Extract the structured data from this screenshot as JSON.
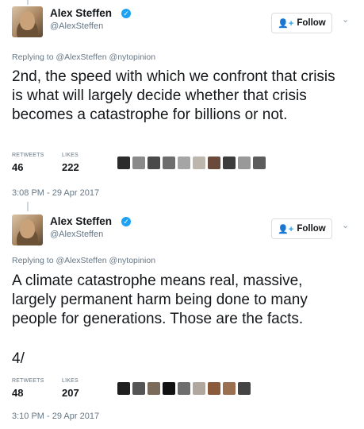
{
  "tweets": [
    {
      "author": "Alex Steffen",
      "handle": "@AlexSteffen",
      "follow_label": "Follow",
      "replying": "Replying to @AlexSteffen @nytopinion",
      "text": "2nd, the speed with which we confront that crisis is what will largely decide whether that crisis becomes a catastrophe for billions or not.",
      "retweets_label": "RETWEETS",
      "retweets": "46",
      "likes_label": "LIKES",
      "likes": "222",
      "timestamp": "3:08 PM - 29 Apr 2017"
    },
    {
      "author": "Alex Steffen",
      "handle": "@AlexSteffen",
      "follow_label": "Follow",
      "replying": "Replying to @AlexSteffen @nytopinion",
      "text": "A climate catastrophe means real, massive, largely permanent harm being done to many people for generations. Those are the facts.",
      "text2": "4/",
      "retweets_label": "RETWEETS",
      "retweets": "48",
      "likes_label": "LIKES",
      "likes": "207",
      "timestamp": "3:10 PM - 29 Apr 2017"
    }
  ],
  "icons": {
    "verified": "✓",
    "follow": "👤+",
    "caret": "⌄"
  },
  "colors": {
    "link_blue": "#1da1f2",
    "muted": "#657786",
    "text": "#14171a"
  }
}
